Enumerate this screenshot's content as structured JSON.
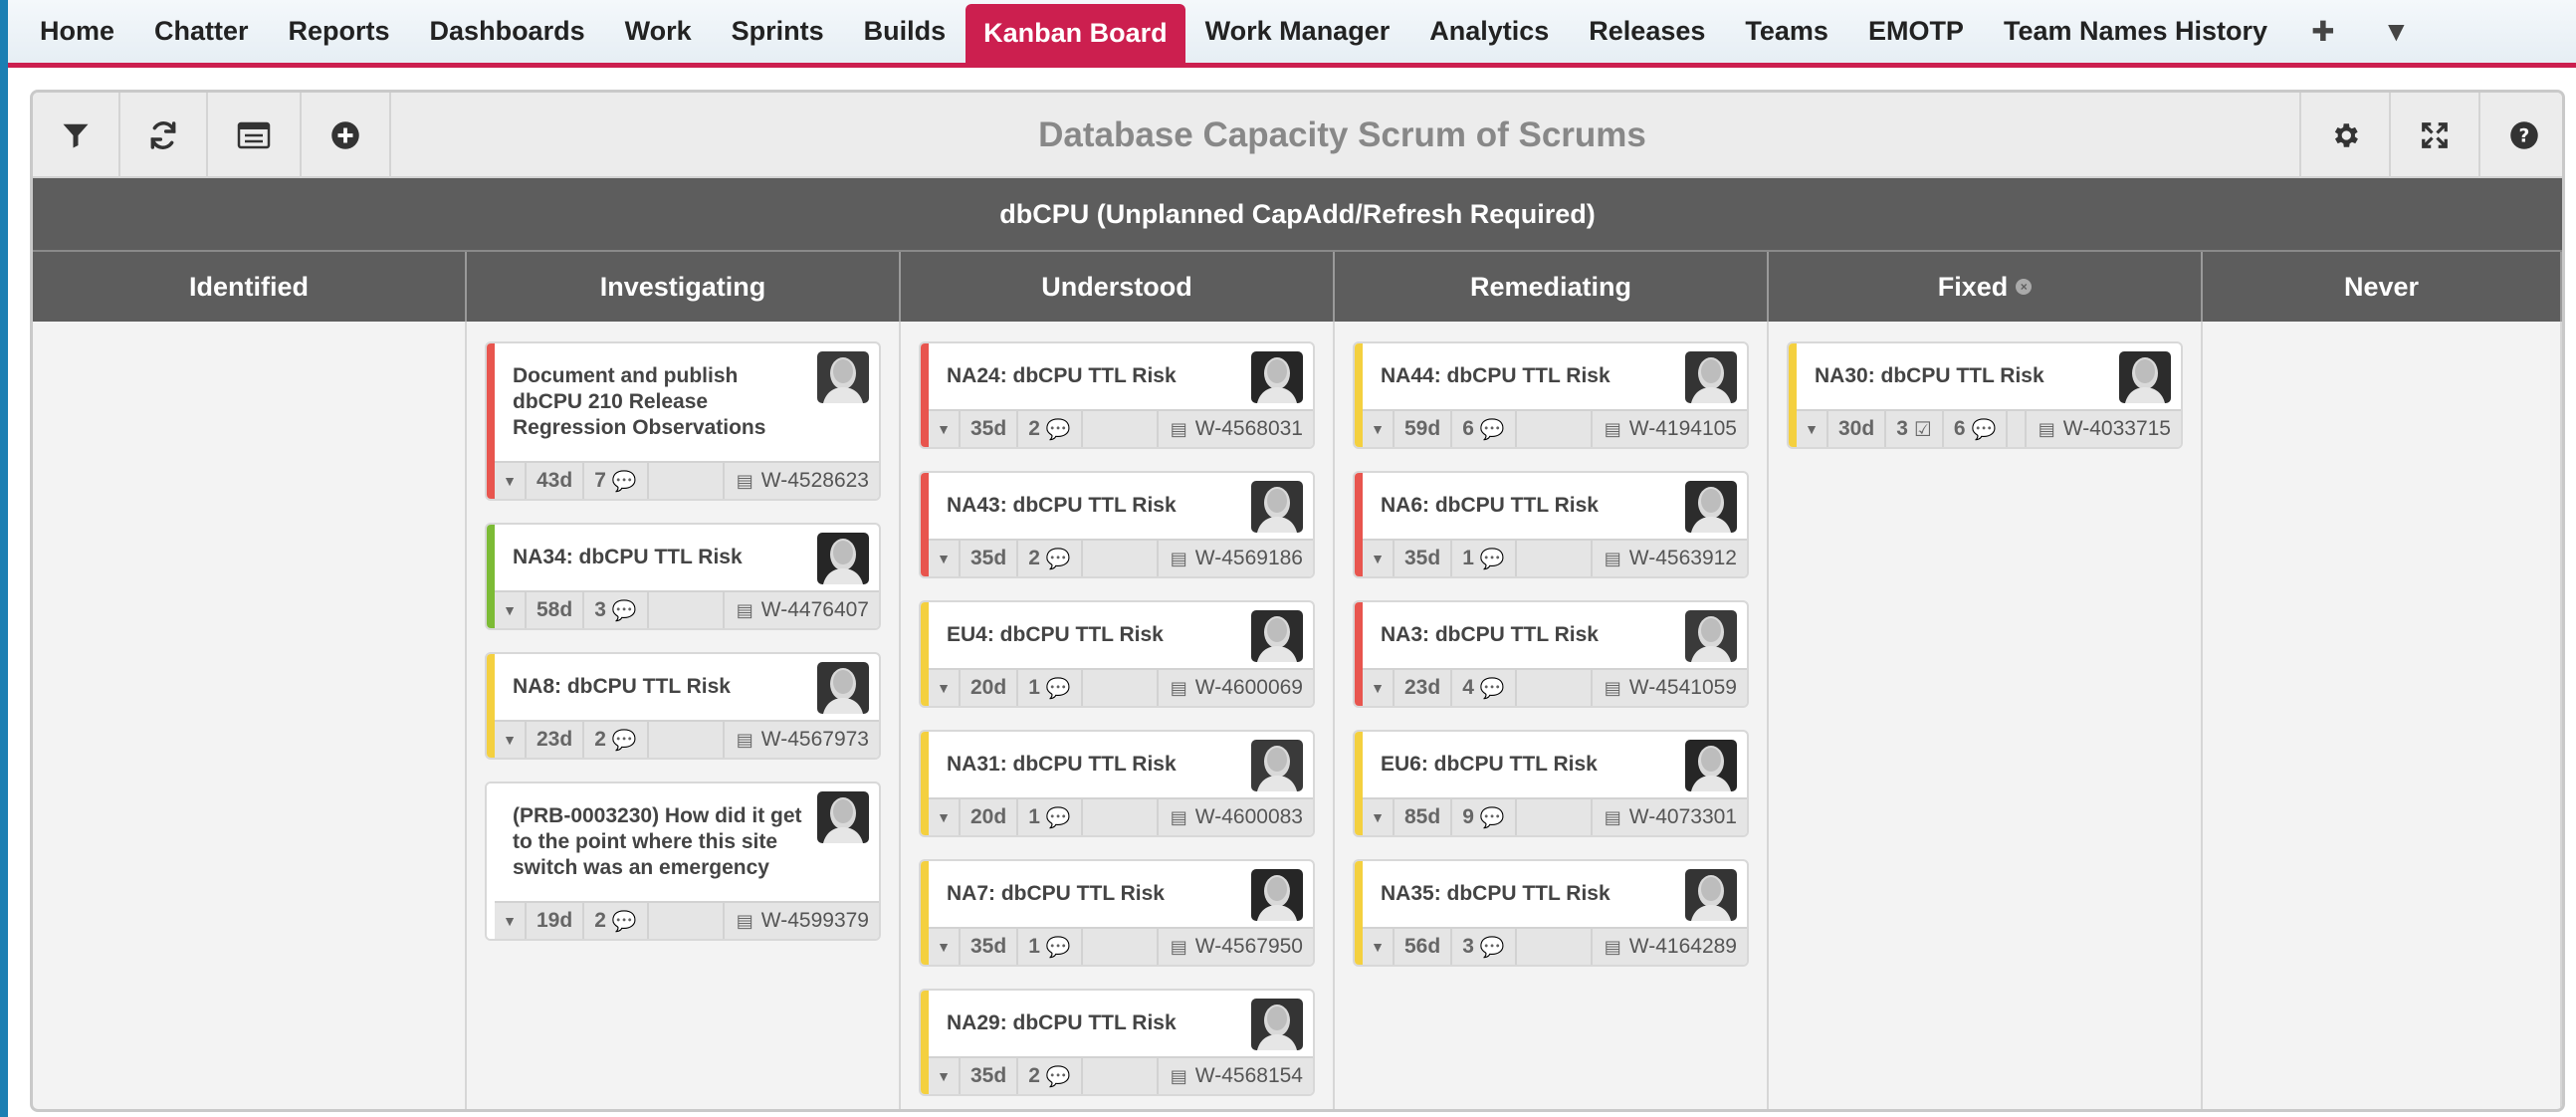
{
  "nav": {
    "tabs": [
      "Home",
      "Chatter",
      "Reports",
      "Dashboards",
      "Work",
      "Sprints",
      "Builds",
      "Kanban Board",
      "Work Manager",
      "Analytics",
      "Releases",
      "Teams",
      "EMOTP",
      "Team Names History"
    ],
    "active": "Kanban Board",
    "add_icon": "plus-icon",
    "more_icon": "chevron-down-icon"
  },
  "toolbar": {
    "left_icons": [
      "filter-icon",
      "refresh-icon",
      "list-view-icon",
      "add-card-icon"
    ],
    "right_icons": [
      "gear-icon",
      "expand-icon",
      "help-icon"
    ],
    "title": "Database Capacity Scrum of Scrums"
  },
  "swimlane": {
    "label": "dbCPU (Unplanned CapAdd/Refresh Required)"
  },
  "colors": {
    "red": "#e8554e",
    "green": "#7cbb35",
    "yellow": "#f4d03f",
    "nav_active": "#cc1f4f"
  },
  "columns": [
    {
      "name": "Identified",
      "cards": []
    },
    {
      "name": "Investigating",
      "cards": [
        {
          "title": "Document and publish dbCPU 210 Release Regression Observations",
          "color": "red",
          "age": "43d",
          "comments": "7",
          "checks": "",
          "work_id": "W-4528623"
        },
        {
          "title": "NA34: dbCPU TTL Risk",
          "color": "green",
          "age": "58d",
          "comments": "3",
          "checks": "",
          "work_id": "W-4476407"
        },
        {
          "title": "NA8: dbCPU TTL Risk",
          "color": "yellow",
          "age": "23d",
          "comments": "2",
          "checks": "",
          "work_id": "W-4567973"
        },
        {
          "title": "(PRB-0003230) How did it get to the point where this site switch was an emergency",
          "color": "none",
          "age": "19d",
          "comments": "2",
          "checks": "",
          "work_id": "W-4599379"
        }
      ]
    },
    {
      "name": "Understood",
      "cards": [
        {
          "title": "NA24: dbCPU TTL Risk",
          "color": "red",
          "age": "35d",
          "comments": "2",
          "checks": "",
          "work_id": "W-4568031"
        },
        {
          "title": "NA43: dbCPU TTL Risk",
          "color": "red",
          "age": "35d",
          "comments": "2",
          "checks": "",
          "work_id": "W-4569186"
        },
        {
          "title": "EU4: dbCPU TTL Risk",
          "color": "yellow",
          "age": "20d",
          "comments": "1",
          "checks": "",
          "work_id": "W-4600069"
        },
        {
          "title": "NA31: dbCPU TTL Risk",
          "color": "yellow",
          "age": "20d",
          "comments": "1",
          "checks": "",
          "work_id": "W-4600083"
        },
        {
          "title": "NA7: dbCPU TTL Risk",
          "color": "yellow",
          "age": "35d",
          "comments": "1",
          "checks": "",
          "work_id": "W-4567950"
        },
        {
          "title": "NA29: dbCPU TTL Risk",
          "color": "yellow",
          "age": "35d",
          "comments": "2",
          "checks": "",
          "work_id": "W-4568154"
        }
      ]
    },
    {
      "name": "Remediating",
      "cards": [
        {
          "title": "NA44: dbCPU TTL Risk",
          "color": "yellow",
          "age": "59d",
          "comments": "6",
          "checks": "",
          "work_id": "W-4194105"
        },
        {
          "title": "NA6: dbCPU TTL Risk",
          "color": "red",
          "age": "35d",
          "comments": "1",
          "checks": "",
          "work_id": "W-4563912"
        },
        {
          "title": "NA3: dbCPU TTL Risk",
          "color": "red",
          "age": "23d",
          "comments": "4",
          "checks": "",
          "work_id": "W-4541059"
        },
        {
          "title": "EU6: dbCPU TTL Risk",
          "color": "yellow",
          "age": "85d",
          "comments": "9",
          "checks": "",
          "work_id": "W-4073301"
        },
        {
          "title": "NA35: dbCPU TTL Risk",
          "color": "yellow",
          "age": "56d",
          "comments": "3",
          "checks": "",
          "work_id": "W-4164289"
        }
      ]
    },
    {
      "name": "Fixed",
      "cards": [
        {
          "title": "NA30: dbCPU TTL Risk",
          "color": "yellow",
          "age": "30d",
          "comments": "6",
          "checks": "3",
          "work_id": "W-4033715"
        }
      ]
    },
    {
      "name": "Never",
      "cards": []
    }
  ]
}
